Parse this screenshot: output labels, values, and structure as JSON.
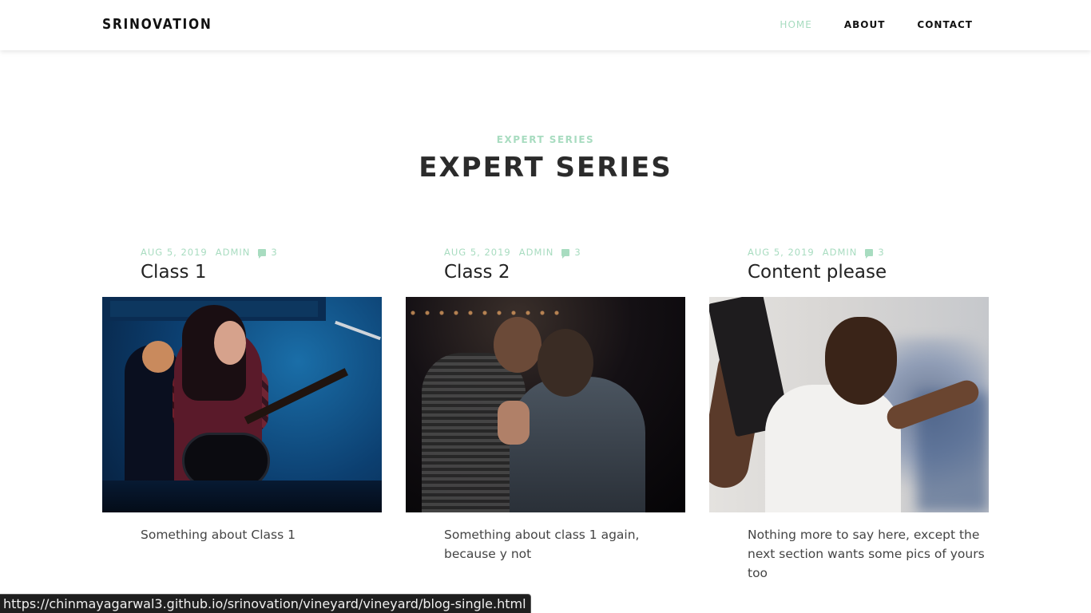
{
  "header": {
    "brand": "SRINOVATION",
    "nav": [
      {
        "label": "HOME",
        "active": true
      },
      {
        "label": "ABOUT",
        "active": false
      },
      {
        "label": "CONTACT",
        "active": false
      }
    ]
  },
  "section": {
    "subheading": "EXPERT SERIES",
    "heading": "EXPERT SERIES"
  },
  "posts": [
    {
      "date": "AUG 5, 2019",
      "author": "ADMIN",
      "comments": "3",
      "title": "Class 1",
      "excerpt": "Something about Class 1"
    },
    {
      "date": "AUG 5, 2019",
      "author": "ADMIN",
      "comments": "3",
      "title": "Class 2",
      "excerpt": "Something about class 1 again, because y not"
    },
    {
      "date": "AUG 5, 2019",
      "author": "ADMIN",
      "comments": "3",
      "title": "Content please",
      "excerpt": "Nothing more to say here, except the next section wants some pics of yours too"
    }
  ],
  "status_url": "https://chinmayagarwal3.github.io/srinovation/vineyard/vineyard/blog-single.html",
  "colors": {
    "accent": "#a8dcc0",
    "text": "#2b2b2b"
  }
}
